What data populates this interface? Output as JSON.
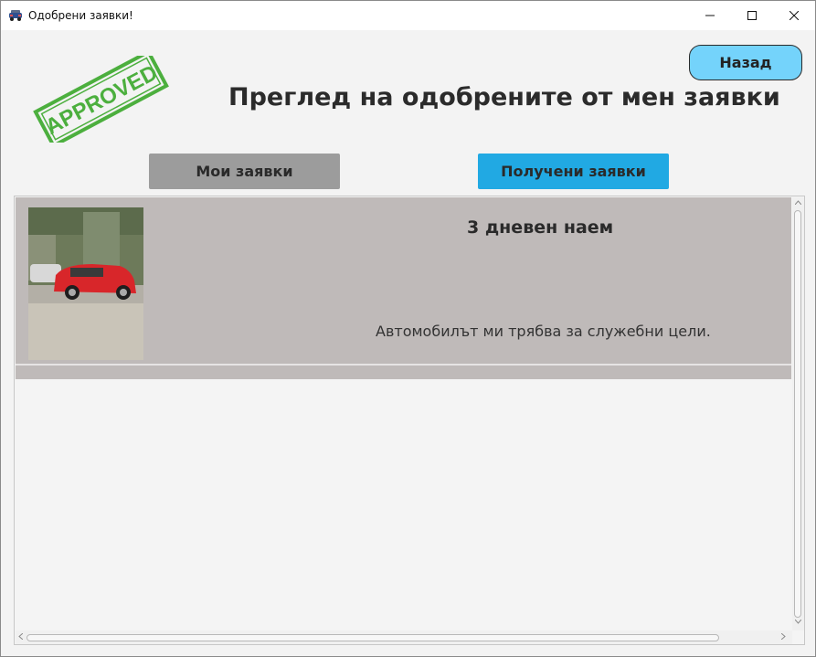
{
  "window": {
    "title": "Одобрени заявки!"
  },
  "stamp": {
    "text": "APPROVED",
    "color": "#4caf3e"
  },
  "header": {
    "title": "Преглед на одобрените от мен заявки",
    "back_label": "Назад"
  },
  "tabs": [
    {
      "label": "Мои заявки",
      "color": "#9c9c9c"
    },
    {
      "label": "Получени заявки",
      "color": "#21a9e3"
    }
  ],
  "requests": [
    {
      "title": "3 дневен наем",
      "description": "Автомобилът ми трябва за служебни цели."
    }
  ],
  "colors": {
    "accent": "#74d3fb",
    "row_bg": "#bfbab9"
  }
}
